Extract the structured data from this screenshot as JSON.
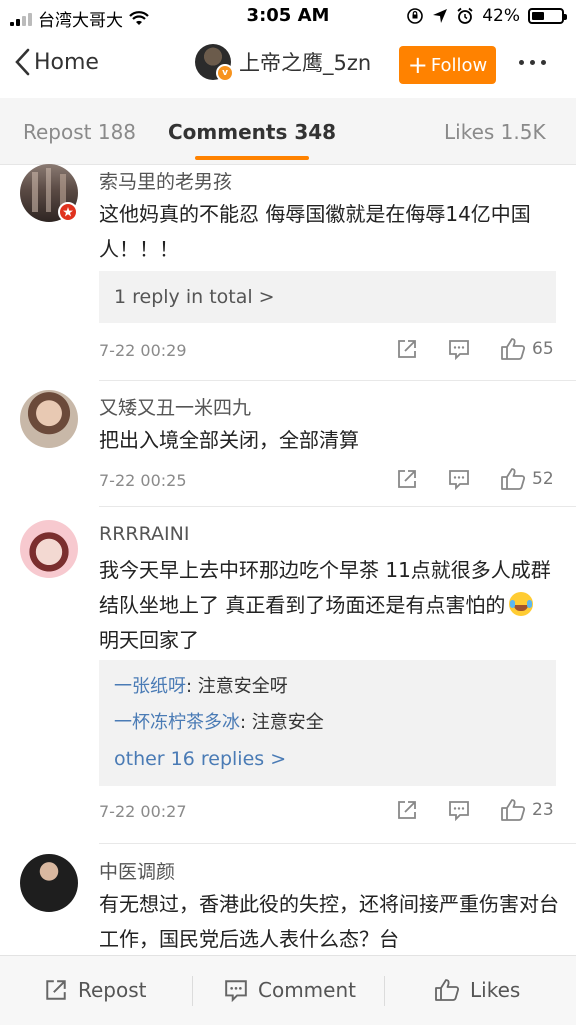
{
  "status_bar": {
    "carrier": "台湾大哥大",
    "time": "3:05 AM",
    "battery": "42%",
    "battery_level": 0.42
  },
  "nav": {
    "back_label": "Home",
    "profile_name": "上帝之鹰_5zn",
    "follow_label": "Follow"
  },
  "tabs": [
    {
      "label": "Repost 188"
    },
    {
      "label": "Comments 348"
    },
    {
      "label": "Likes 1.5K"
    }
  ],
  "comments": [
    {
      "user": "索马里的老男孩",
      "text": "这他妈真的不能忍 侮辱国徽就是在侮辱14亿中国人！！！",
      "reply_summary": "1 reply in total >",
      "time": "7-22 00:29",
      "likes": "65"
    },
    {
      "user": "又矮又丑一米四九",
      "text": "把出入境全部关闭，全部清算",
      "time": "7-22 00:25",
      "likes": "52"
    },
    {
      "user": "RRRRAINI",
      "text": "我今天早上去中环那边吃个早茶 11点就很多人成群结队坐地上了 真正看到了场面还是有点害怕的",
      "text_tail": " 明天回家了",
      "replies": [
        {
          "user": "一张纸呀",
          "text": ": 注意安全呀"
        },
        {
          "user": "一杯冻柠茶多冰",
          "text": ": 注意安全"
        }
      ],
      "more_replies": "other 16 replies >",
      "time": "7-22 00:27",
      "likes": "23"
    },
    {
      "user": "中医调颜",
      "text": "有无想过，香港此役的失控，还将间接严重伤害对台工作，国民党后选人表什么态？台"
    }
  ],
  "bottom_bar": {
    "repost": "Repost",
    "comment": "Comment",
    "likes": "Likes"
  },
  "colors": {
    "accent": "#ff8200",
    "link": "#4a7bb5"
  }
}
